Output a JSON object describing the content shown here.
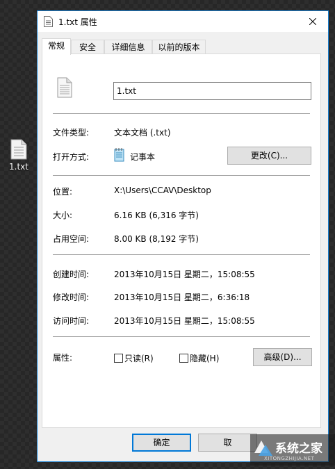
{
  "desktop": {
    "icon_label": "1.txt"
  },
  "window": {
    "title": "1.txt 属性",
    "tabs": [
      "常规",
      "安全",
      "详细信息",
      "以前的版本"
    ],
    "filename": "1.txt",
    "rows": {
      "type": {
        "label": "文件类型:",
        "value": "文本文档 (.txt)"
      },
      "open_with": {
        "label": "打开方式:",
        "value": "记事本",
        "button": "更改(C)..."
      },
      "location": {
        "label": "位置:",
        "value": "X:\\Users\\CCAV\\Desktop"
      },
      "size": {
        "label": "大小:",
        "value": "6.16 KB (6,316 字节)"
      },
      "size_on_disk": {
        "label": "占用空间:",
        "value": "8.00 KB (8,192 字节)"
      },
      "created": {
        "label": "创建时间:",
        "value": "2013年10月15日 星期二，15:08:55"
      },
      "modified": {
        "label": "修改时间:",
        "value": "2013年10月15日 星期二，6:36:18"
      },
      "accessed": {
        "label": "访问时间:",
        "value": "2013年10月15日 星期二，15:08:55"
      },
      "attributes": {
        "label": "属性:",
        "readonly": "只读(R)",
        "hidden": "隐藏(H)",
        "advanced": "高级(D)..."
      }
    },
    "footer": {
      "ok": "确定",
      "cancel": "取"
    }
  },
  "watermark": {
    "text": "系统之家",
    "subtext": "XITONGZHIJIA.NET"
  },
  "colors": {
    "accent": "#0078d7",
    "window_border": "#1883d7"
  }
}
